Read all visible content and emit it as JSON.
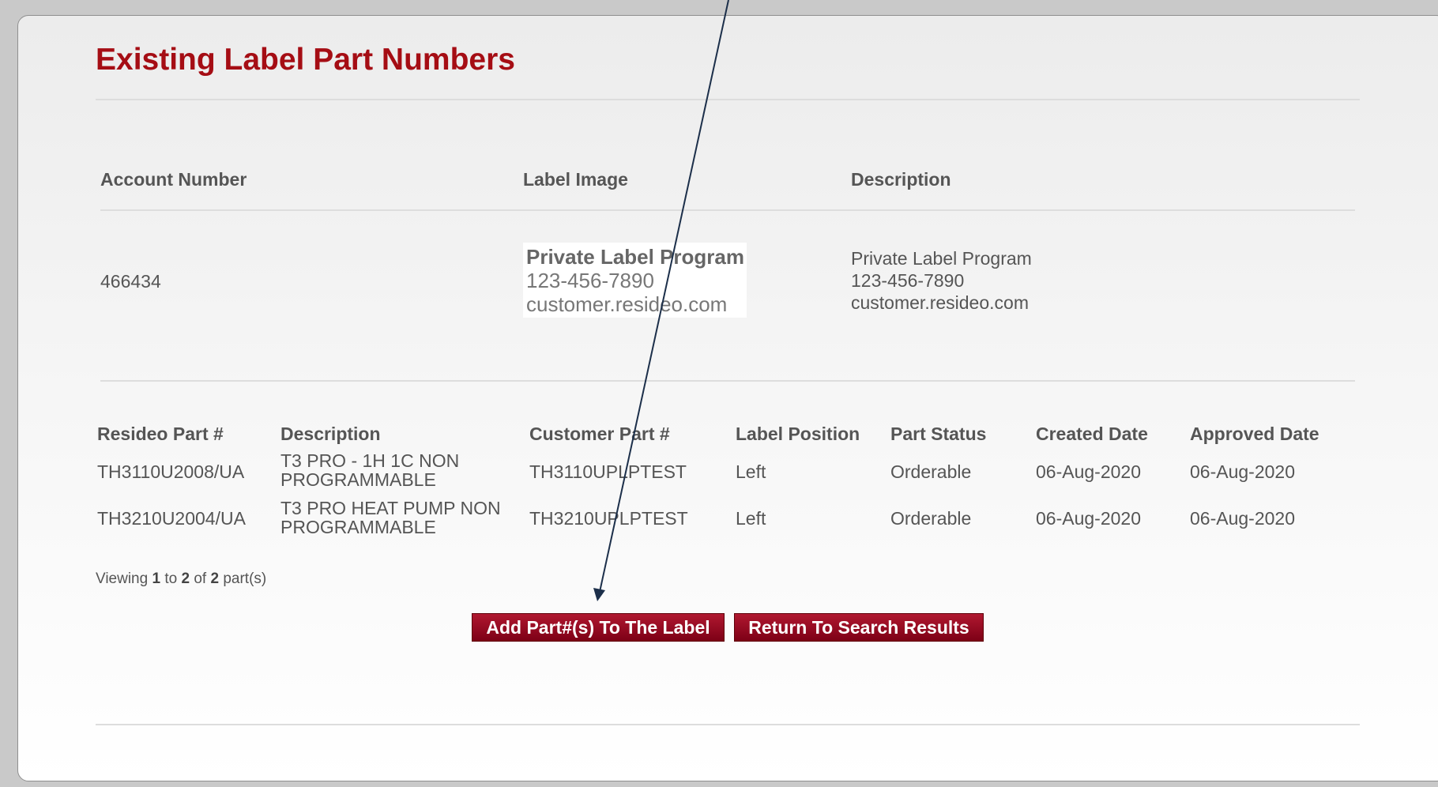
{
  "page": {
    "title": "Existing Label Part Numbers"
  },
  "label_table": {
    "headers": {
      "account_number": "Account Number",
      "label_image": "Label Image",
      "description": "Description"
    },
    "row": {
      "account_number": "466434",
      "label_image_lines": [
        "Private Label Program",
        "123-456-7890",
        "customer.resideo.com"
      ],
      "description_lines": [
        "Private Label Program",
        "123-456-7890",
        "customer.resideo.com"
      ]
    }
  },
  "parts_table": {
    "headers": [
      "Resideo Part #",
      "Description",
      "Customer Part #",
      "Label Position",
      "Part Status",
      "Created Date",
      "Approved Date"
    ],
    "rows": [
      {
        "resideo_part": "TH3110U2008/UA",
        "description": "T3 PRO - 1H 1C NON PROGRAMMABLE",
        "customer_part": "TH3110UPLPTEST",
        "label_position": "Left",
        "part_status": "Orderable",
        "created_date": "06-Aug-2020",
        "approved_date": "06-Aug-2020"
      },
      {
        "resideo_part": "TH3210U2004/UA",
        "description": "T3 PRO HEAT PUMP NON PROGRAMMABLE",
        "customer_part": "TH3210UPLPTEST",
        "label_position": "Left",
        "part_status": "Orderable",
        "created_date": "06-Aug-2020",
        "approved_date": "06-Aug-2020"
      }
    ]
  },
  "pagination": {
    "prefix": "Viewing",
    "from": "1",
    "to_word": "to",
    "to": "2",
    "of_word": "of",
    "total": "2",
    "suffix": "part(s)"
  },
  "buttons": {
    "add_parts": "Add Part#(s) To The Label",
    "return": "Return To Search Results"
  },
  "colors": {
    "title": "#a50d14",
    "button": "#8f0a1f",
    "annotation_arrow": "#1c2f4a"
  }
}
